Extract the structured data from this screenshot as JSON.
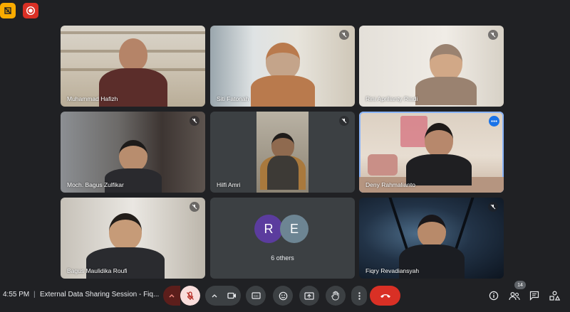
{
  "meeting": {
    "time": "4:55 PM",
    "separator": "|",
    "title": "External Data Sharing Session - Fiq...",
    "participant_count": "14",
    "others_label": "6 others",
    "avatars": [
      "R",
      "E"
    ]
  },
  "participants": [
    {
      "name": "Muhammad Hafizh",
      "muted": false
    },
    {
      "name": "Siti Fatonah",
      "muted": true
    },
    {
      "name": "Rini Aprilianty Riadi",
      "muted": true
    },
    {
      "name": "Moch. Bagus Zulfikar",
      "muted": true
    },
    {
      "name": "Hilfi Amri",
      "muted": true
    },
    {
      "name": "Deny Rahmalianto",
      "muted": false,
      "active": true
    },
    {
      "name": "Bagus Maulidika Roufi",
      "muted": true
    },
    {
      "name": "Fiqry Revadiansyah",
      "muted": true
    }
  ],
  "colors": {
    "background": "#202124",
    "tile": "#3c4043",
    "active_outline": "#8ab4f8",
    "leave": "#d93025",
    "mic_muted_bg": "#f9dedc"
  },
  "icons": {
    "top_left": [
      "notes-icon",
      "recording-icon"
    ],
    "toolbar": [
      "mic-options-icon",
      "mic-off-icon",
      "camera-options-icon",
      "camera-icon",
      "captions-icon",
      "emoji-icon",
      "present-icon",
      "raise-hand-icon",
      "more-options-icon",
      "leave-call-icon"
    ],
    "right": [
      "info-icon",
      "people-icon",
      "chat-icon",
      "activities-icon"
    ]
  }
}
